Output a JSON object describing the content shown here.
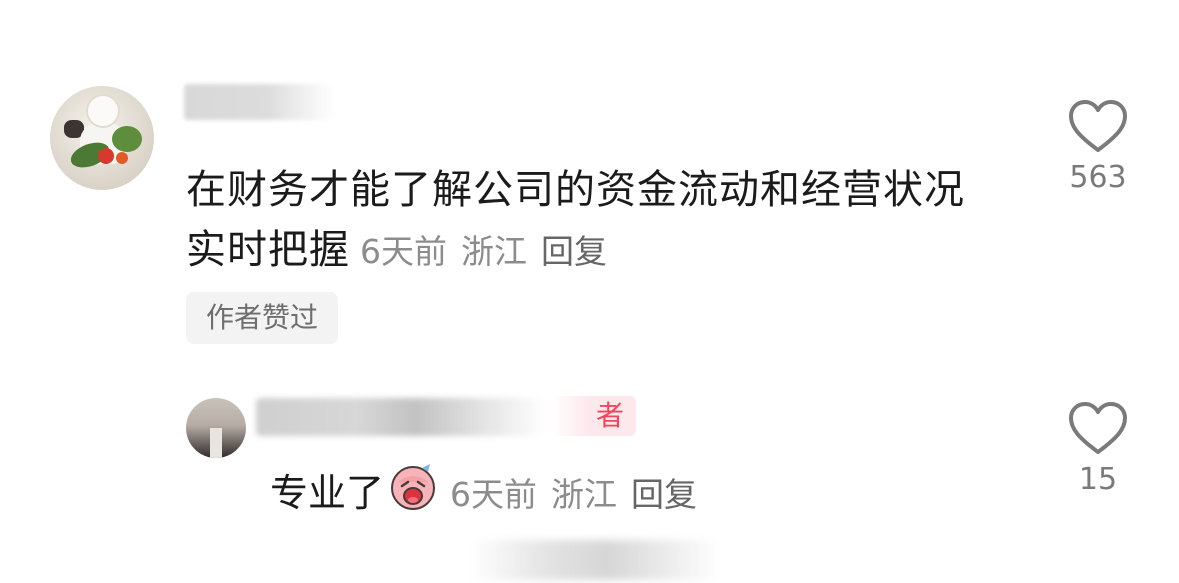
{
  "comments": [
    {
      "text": "在财务才能了解公司的资金流动和经营状况实时把握",
      "time": "6天前",
      "location": "浙江",
      "reply_label": "回复",
      "badge": "作者赞过",
      "like_count": "563",
      "like_icon": "heart-outline-icon"
    },
    {
      "text": "专业了",
      "emoji_icon": "crying-face-emoji",
      "time": "6天前",
      "location": "浙江",
      "reply_label": "回复",
      "author_tag": "者",
      "like_count": "15",
      "like_icon": "heart-outline-icon"
    }
  ],
  "colors": {
    "text": "#1b1b1b",
    "meta": "#8c8c8c",
    "author_tag": "#f2455d",
    "badge_bg": "#f3f3f3"
  }
}
